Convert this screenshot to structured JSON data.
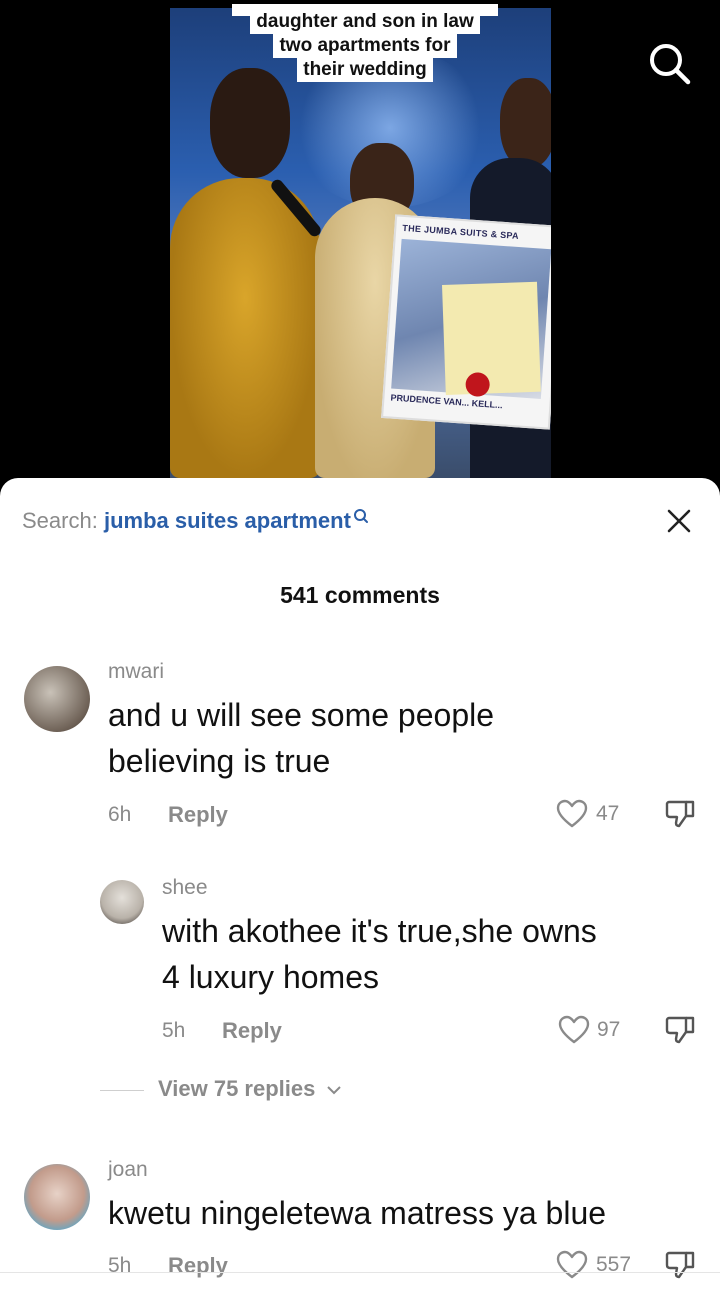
{
  "video": {
    "caption_lines": [
      "daughter and son in law",
      "two apartments for",
      "their wedding"
    ],
    "board_title": "THE JUMBA SUITS & SPA",
    "board_footer": "PRUDENCE VAN... KELL..."
  },
  "sheet": {
    "search_label": "Search:",
    "search_term": "jumba suites apartment",
    "comment_count": "541 comments"
  },
  "comments": [
    {
      "username": "mwari",
      "text_lines": [
        "and u will see some people",
        "believing is true"
      ],
      "age": "6h",
      "reply_label": "Reply",
      "likes": "47"
    },
    {
      "username": "shee",
      "text_lines": [
        "with akothee it's true,she owns",
        "4 luxury homes"
      ],
      "age": "5h",
      "reply_label": "Reply",
      "likes": "97"
    },
    {
      "username": "joan",
      "text_lines": [
        "kwetu ningeletewa matress ya blue"
      ],
      "age": "5h",
      "reply_label": "Reply",
      "likes": "557"
    }
  ],
  "view_replies_label": "View 75 replies",
  "icons": {
    "search": "search-icon",
    "close": "close-icon",
    "heart": "heart-outline-icon",
    "dislike": "thumbs-down-icon",
    "chevron": "chevron-down-icon"
  },
  "colors": {
    "search_term": "#2a5ea8",
    "muted": "#8a8a8a"
  }
}
